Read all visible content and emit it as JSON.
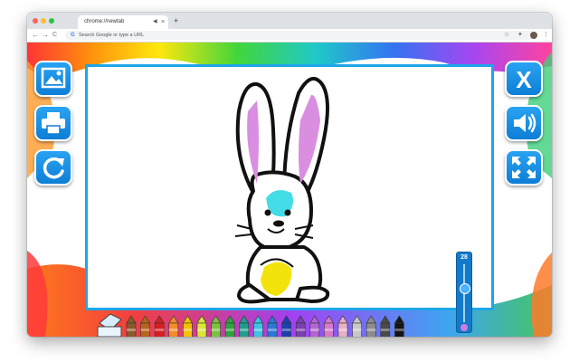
{
  "browser": {
    "tab_title": "chrome://newtab",
    "audio_icon": "speaker-icon",
    "close_glyph": "×",
    "new_tab_glyph": "+",
    "address_placeholder": "Search Google or type a URL",
    "google_glyph": "G"
  },
  "toolbar": {
    "back": "←",
    "forward": "→",
    "reload": "C",
    "star": "☆",
    "menu": "⋮"
  },
  "app": {
    "left_buttons": [
      "image-icon",
      "printer-icon",
      "reset-icon"
    ],
    "right_buttons": [
      "close-x-icon",
      "sound-icon",
      "fullscreen-icon"
    ],
    "close_label": "X",
    "brush_size": "28",
    "selected_color": "#cc7ee0",
    "accent": "#1da6e8",
    "crayons": [
      "#8a5a2b",
      "#b5651d",
      "#d62020",
      "#f28c28",
      "#f2c200",
      "#d8e835",
      "#7cc242",
      "#2ea43f",
      "#1f9e8e",
      "#3cc3e6",
      "#2a78d6",
      "#1d3fae",
      "#7a3fb0",
      "#b564d8",
      "#d879c9",
      "#e6b0c8",
      "#c7c7c7",
      "#8c8c8c",
      "#4a4a4a",
      "#151515"
    ]
  }
}
